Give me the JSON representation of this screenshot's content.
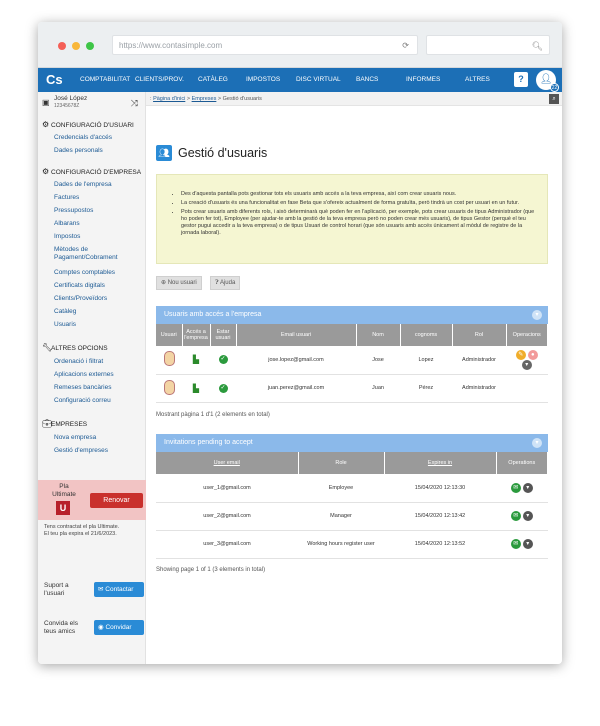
{
  "browser": {
    "url": "https://www.contasimple.com"
  },
  "colors": {
    "brand": "#1c6fb6",
    "accent": "#2a8bd6",
    "danger": "#c9302c",
    "panel_header": "#8bb9ea",
    "success": "#2b9a3d"
  },
  "nav": {
    "logo": "Cs",
    "items": [
      "COMPTABILITAT",
      "CLIENTS/PROV.",
      "CATÀLEG",
      "IMPOSTOS",
      "DISC VIRTUAL",
      "BANCS",
      "INFORMES",
      "ALTRES"
    ],
    "help": "?",
    "badge": "22"
  },
  "sidebar": {
    "user_name": "José López",
    "user_id": "12345678Z",
    "sections": [
      {
        "title": "CONFIGURACIÓ D'USUARI",
        "icon": "gear-icon",
        "items": [
          "Credencials d'accés",
          "Dades personals"
        ]
      },
      {
        "title": "CONFIGURACIÓ D'EMPRESA",
        "icon": "gear-icon",
        "items": [
          "Dades de l'empresa",
          "Factures",
          "Pressupostos",
          "Albarans",
          "Impostos",
          "Mètodes de Pagament/Cobrament",
          "Comptes comptables",
          "Certificats digitals",
          "Clients/Proveïdors",
          "Catàleg",
          "Usuaris"
        ]
      },
      {
        "title": "ALTRES OPCIONS",
        "icon": "wrench-icon",
        "items": [
          "Ordenació i filtrat",
          "Aplicacions externes",
          "Remeses bancàries",
          "Configuració correu"
        ]
      },
      {
        "title": "EMPRESES",
        "icon": "briefcase-icon",
        "items": [
          "Nova empresa",
          "Gestió d'empreses"
        ]
      }
    ],
    "plan": {
      "label_line1": "Pla",
      "label_line2": "Ultimate",
      "letter": "U",
      "renew": "Renovar",
      "note_line1": "Tens contractat el pla Ultimate.",
      "note_line2": "El teu pla expira el 21/6/2023."
    },
    "support": {
      "line1": "Suport a",
      "line2": "l'usuari",
      "button": "Contactar"
    },
    "invite": {
      "line1": "Convida els",
      "line2": "teus amics",
      "button": "Convidar"
    }
  },
  "breadcrumb": {
    "home": "Pàgina d'inici",
    "sep1": " > ",
    "empreses": "Empreses",
    "sep2": " > ",
    "current": "Gestió d'usuaris"
  },
  "page": {
    "title": "Gestió d'usuaris",
    "info": [
      "Des d'aquesta pantalla pots gestionar tots els usuaris amb accés a la teva empresa, així com crear usuaris nous.",
      "La creació d'usuaris és una funcionalitat en fase Beta que s'ofereix actualment de forma gratuïta, però tindrà un cost per usuari en un futur.",
      "Pots crear usuaris amb diferents rols, i això determinarà què poden fer en l'aplicació, per exemple, pots crear usuaris de tipus Administrador (que ho poden fer tot), Employee (per ajudar-te amb la gestió de la teva empresa però no poden crear més usuaris), de tipus Gestor (perquè el teu gestor pugui accedir a la teva empresa) o de tipus Usuari de control horari (que són usuaris amb accés únicament al mòdul de registre de la jornada laboral)."
    ],
    "new_user": "Nou usuari",
    "help": "Ajuda"
  },
  "users_panel": {
    "title": "Usuaris amb accés a l'empresa",
    "columns": [
      "Usuari",
      "Accés a l'empresa",
      "Estar usuari",
      "Email usuari",
      "Nom",
      "cognoms",
      "Rol",
      "Operacions"
    ],
    "rows": [
      {
        "email": "jose.lopez@gmail.com",
        "name": "Jose",
        "surname": "Lopez",
        "role": "Administrador"
      },
      {
        "email": "juan.perez@gmail.com",
        "name": "Juan",
        "surname": "Pérez",
        "role": "Administrador"
      }
    ],
    "footer": "Mostrant pàgina 1 d'1 (2 elements en total)"
  },
  "invitations_panel": {
    "title": "Invitations pending to accept",
    "columns": [
      "User email",
      "Role",
      "Expires in",
      "Operations"
    ],
    "rows": [
      {
        "email": "user_1@gmail.com",
        "role": "Employee",
        "expires": "15/04/2020 12:13:30"
      },
      {
        "email": "user_2@gmail.com",
        "role": "Manager",
        "expires": "15/04/2020 12:13:42"
      },
      {
        "email": "user_3@gmail.com",
        "role": "Working hours register user",
        "expires": "15/04/2020 12:13:52"
      }
    ],
    "footer": "Showing page 1 of 1 (3 elements in total)"
  }
}
